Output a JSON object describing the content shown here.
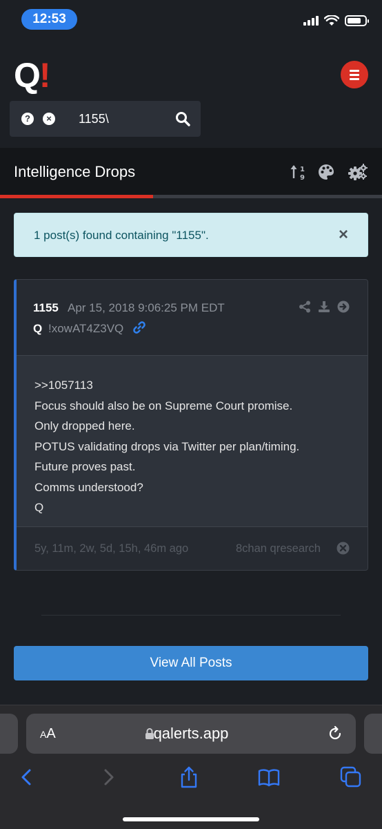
{
  "status_bar": {
    "time": "12:53"
  },
  "app": {
    "logo_q": "Q",
    "logo_bang": "!",
    "search": {
      "help_glyph": "?",
      "clear_glyph": "×",
      "value": "1155\\"
    }
  },
  "section": {
    "title": "Intelligence Drops",
    "progress": 0.4
  },
  "alert": {
    "text": "1 post(s) found containing \"1155\".",
    "close": "×"
  },
  "post": {
    "number": "1155",
    "date": "Apr 15, 2018 9:06:25 PM EDT",
    "author": "Q",
    "tripcode": "!xowAT4Z3VQ",
    "lines": [
      ">>1057113",
      "Focus should also be on Supreme Court promise.",
      "Only dropped here.",
      "POTUS validating drops via Twitter per plan/timing.",
      "Future proves past.",
      "Comms understood?",
      "Q"
    ],
    "age": "5y, 11m, 2w, 5d, 15h, 46m ago",
    "source": "8chan qresearch"
  },
  "view_all_label": "View All Posts",
  "browser": {
    "aa_small": "A",
    "aa_large": "A",
    "url": "qalerts.app"
  },
  "colors": {
    "accent_red": "#d93025",
    "accent_blue": "#3a87d2",
    "link_blue": "#2f80ed"
  }
}
